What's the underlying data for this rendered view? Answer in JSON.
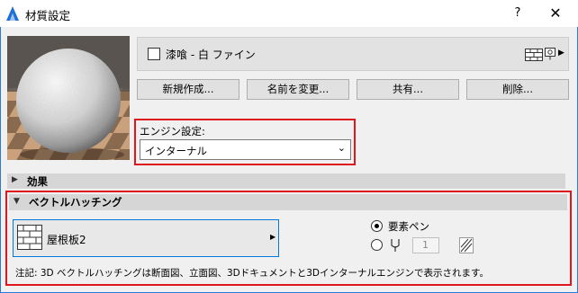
{
  "window": {
    "title": "材質設定",
    "help_label": "?",
    "close_label": "✕"
  },
  "material": {
    "name": "漆喰 - 白 ファイン"
  },
  "buttons": {
    "new": "新規作成...",
    "rename": "名前を変更...",
    "share": "共有...",
    "delete": "削除..."
  },
  "engine": {
    "label": "エンジン設定:",
    "value": "インターナル"
  },
  "sections": {
    "effects": "効果",
    "vector_hatching": "ベクトルハッチング"
  },
  "hatching": {
    "pattern_name": "屋根板2",
    "radio_element_pen": "要素ペン",
    "pen_number": "1",
    "selected_option": "要素ペン"
  },
  "note": "注記: 3D ベクトルハッチングは断面図、立面図、3Dドキュメントと3Dインターナルエンジンで表示されます。",
  "colors": {
    "highlight_red": "#e0161f",
    "focus_blue": "#0078d7"
  }
}
